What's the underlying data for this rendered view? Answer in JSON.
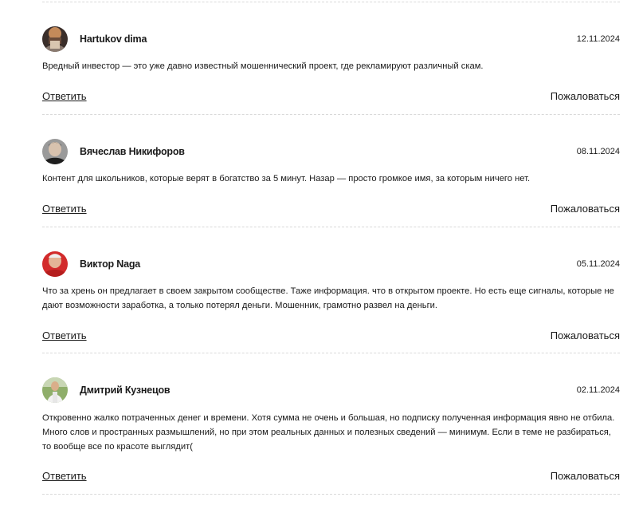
{
  "comments": [
    {
      "author": "Hartukov dima",
      "date": "12.11.2024",
      "text": "Вредный инвестор — это уже давно известный мошеннический проект, где рекламируют различный скам.",
      "reply_label": "Ответить",
      "report_label": "Пожаловаться",
      "avatar_icon": "avatar-photo"
    },
    {
      "author": "Вячеслав Никифоров",
      "date": "08.11.2024",
      "text": "Контент для школьников, которые верят в богатство за 5 минут. Назар — просто громкое имя, за которым ничего нет.",
      "reply_label": "Ответить",
      "report_label": "Пожаловаться",
      "avatar_icon": "avatar-photo"
    },
    {
      "author": "Виктор Naga",
      "date": "05.11.2024",
      "text": "Что за хрень он предлагает в своем закрытом сообществе. Таже информация. что в открытом проекте. Но есть еще сигналы, которые не дают возможности заработка, а только потерял деньги. Мошенник, грамотно развел на деньги.",
      "reply_label": "Ответить",
      "report_label": "Пожаловаться",
      "avatar_icon": "avatar-photo"
    },
    {
      "author": "Дмитрий Кузнецов",
      "date": "02.11.2024",
      "text": "Откровенно жалко потраченных денег и времени. Хотя сумма не очень и большая, но подписку полученная информация явно не отбила. Много слов и пространных размышлений, но при этом реальных данных и полезных сведений — минимум. Если в теме не разбираться, то вообще все по красоте выглядит(",
      "reply_label": "Ответить",
      "report_label": "Пожаловаться",
      "avatar_icon": "avatar-photo"
    }
  ]
}
